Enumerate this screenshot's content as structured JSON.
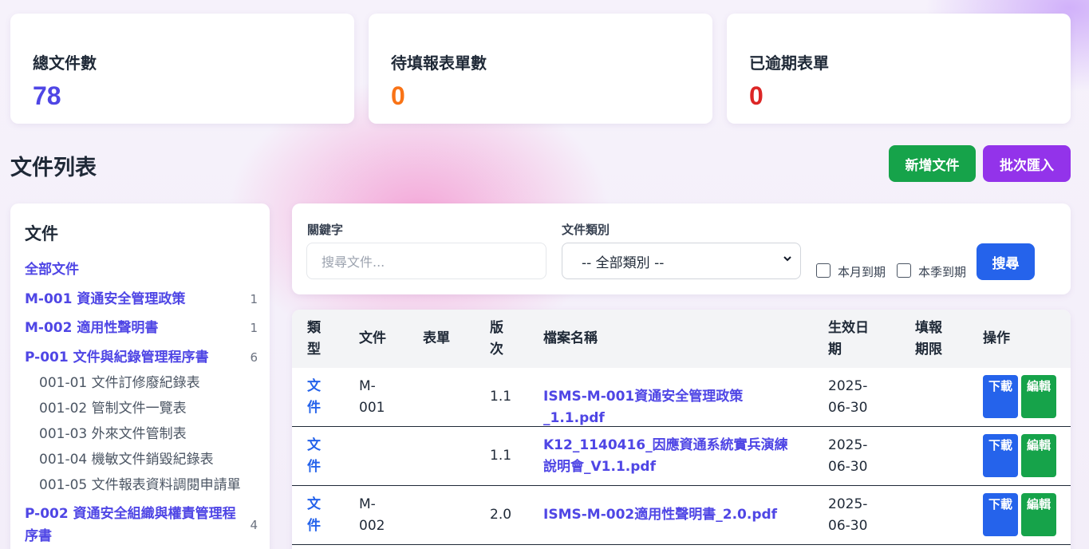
{
  "stats": [
    {
      "label": "總文件數",
      "value": "78",
      "color": "#4f46e5"
    },
    {
      "label": "待填報表單數",
      "value": "0",
      "color": "#f97316"
    },
    {
      "label": "已逾期表單",
      "value": "0",
      "color": "#dc2626"
    }
  ],
  "section_title": "文件列表",
  "actions": {
    "add_label": "新增文件",
    "import_label": "批次匯入"
  },
  "sidebar": {
    "title": "文件",
    "all_label": "全部文件",
    "items": [
      {
        "label": "M-001 資通安全管理政策",
        "count": "1"
      },
      {
        "label": "M-002 適用性聲明書",
        "count": "1"
      },
      {
        "label": "P-001 文件與紀錄管理程序書",
        "count": "6"
      },
      {
        "label": "P-002 資通安全組織與權責管理程序書",
        "count": "4"
      }
    ],
    "sub_items": [
      "001-01 文件訂修廢紀錄表",
      "001-02 管制文件一覽表",
      "001-03 外來文件管制表",
      "001-04 機敏文件銷毀紀錄表",
      "001-05 文件報表資料調閱申請單"
    ]
  },
  "filter": {
    "keyword_label": "關鍵字",
    "keyword_placeholder": "搜尋文件...",
    "category_label": "文件類別",
    "category_value": "-- 全部類別 --",
    "due_month_label": "本月到期",
    "due_quarter_label": "本季到期",
    "search_label": "搜尋"
  },
  "table": {
    "headers": {
      "type": "類型",
      "file": "文件",
      "form": "表單",
      "version": "版次",
      "filename": "檔案名稱",
      "effective": "生效日期",
      "deadline": "填報期限",
      "actions": "操作"
    },
    "rows": [
      {
        "type": "文件",
        "file": "M-001",
        "form": "",
        "version": "1.1",
        "filename": "ISMS-M-001資通安全管理政策_1.1.pdf",
        "effective": "2025-06-30",
        "deadline": "",
        "download": "下載",
        "edit": "編輯"
      },
      {
        "type": "文件",
        "file": "",
        "form": "",
        "version": "1.1",
        "filename": "K12_1140416_因應資通系統實兵演練說明會_V1.1.pdf",
        "effective": "2025-06-30",
        "deadline": "",
        "download": "下載",
        "edit": "編輯"
      },
      {
        "type": "文件",
        "file": "M-002",
        "form": "",
        "version": "2.0",
        "filename": "ISMS-M-002適用性聲明書_2.0.pdf",
        "effective": "2025-06-30",
        "deadline": "",
        "download": "下載",
        "edit": "編輯"
      }
    ]
  }
}
